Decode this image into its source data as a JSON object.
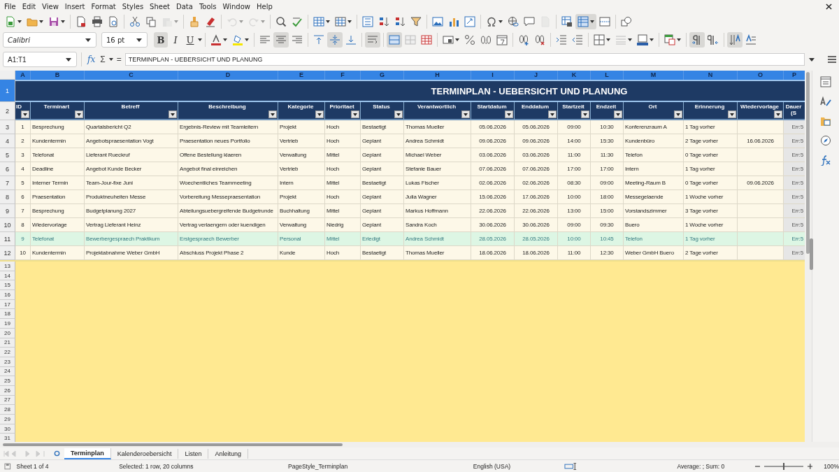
{
  "menu": [
    "File",
    "Edit",
    "View",
    "Insert",
    "Format",
    "Styles",
    "Sheet",
    "Data",
    "Tools",
    "Window",
    "Help"
  ],
  "standard_toolbar": {
    "paste_disabled": true,
    "undo_disabled": true,
    "redo_disabled": true,
    "header_footer_disabled": true,
    "freeze_active": true
  },
  "format_toolbar": {
    "font_name": "Calibri",
    "font_size": "16 pt",
    "text_buttons": [
      {
        "label": "B",
        "active": true
      },
      {
        "label": "I",
        "active": false
      },
      {
        "label": "U",
        "active": false
      }
    ],
    "align_left_active": false,
    "align_center_active": true,
    "align_right_active": false,
    "align_top_active": false,
    "align_middle_active": true,
    "align_bottom_active": false,
    "wrap_active": true,
    "merge_active": true,
    "ltr_active": true,
    "rtl_active": false,
    "vertical_text_active": true
  },
  "formula_bar": {
    "name_box": "A1:T1",
    "function_wizard": "fx",
    "sum": "Σ",
    "equals": "=",
    "content": "TERMINPLAN - UEBERSICHT UND PLANUNG"
  },
  "columns": [
    {
      "letter": "A",
      "selected": true,
      "header": "ID"
    },
    {
      "letter": "B",
      "selected": true,
      "header": "Terminart"
    },
    {
      "letter": "C",
      "selected": true,
      "header": "Betreff"
    },
    {
      "letter": "D",
      "selected": true,
      "header": "Beschreibung"
    },
    {
      "letter": "E",
      "selected": true,
      "header": "Kategorie"
    },
    {
      "letter": "F",
      "selected": true,
      "header": "Prioritaet"
    },
    {
      "letter": "G",
      "selected": true,
      "header": "Status"
    },
    {
      "letter": "H",
      "selected": true,
      "header": "Verantwortlich"
    },
    {
      "letter": "I",
      "selected": true,
      "header": "Startdatum"
    },
    {
      "letter": "J",
      "selected": true,
      "header": "Enddatum"
    },
    {
      "letter": "K",
      "selected": true,
      "header": "Startzeit"
    },
    {
      "letter": "L",
      "selected": true,
      "header": "Endzeit"
    },
    {
      "letter": "M",
      "selected": true,
      "header": "Ort"
    },
    {
      "letter": "N",
      "selected": true,
      "header": "Erinnerung"
    },
    {
      "letter": "O",
      "selected": true,
      "header": "Wiedervorlage"
    },
    {
      "letter": "P",
      "selected": true,
      "header": "Dauer (S"
    }
  ],
  "title_row": {
    "number": "1",
    "selected": true,
    "title": "TERMINPLAN - UEBERSICHT UND PLANUNG"
  },
  "header_row": {
    "number": "2",
    "selected": false
  },
  "rows": [
    {
      "number": "3",
      "highlighted": false,
      "cells": [
        "1",
        "Besprechung",
        "Quartalsbericht Q2",
        "Ergebnis-Review mit Teamleitern",
        "Projekt",
        "Hoch",
        "Bestaetigt",
        "Thomas Mueller",
        "05.06.2026",
        "05.06.2026",
        "09:00",
        "10:30",
        "Konferenzraum A",
        "1 Tag vorher",
        "",
        "Err:5"
      ]
    },
    {
      "number": "4",
      "highlighted": false,
      "cells": [
        "2",
        "Kundentermin",
        "Angebotspraesentation Vogt",
        "Praesentation neues Portfolio",
        "Vertrieb",
        "Hoch",
        "Geplant",
        "Andrea Schmidt",
        "09.06.2026",
        "09.06.2026",
        "14:00",
        "15:30",
        "Kundenbüro",
        "2 Tage vorher",
        "16.06.2026",
        "Err:5"
      ]
    },
    {
      "number": "5",
      "highlighted": false,
      "cells": [
        "3",
        "Telefonat",
        "Lieferant Rueckruf",
        "Offene Bestellung klaeren",
        "Verwaltung",
        "Mittel",
        "Geplant",
        "Michael Weber",
        "03.06.2026",
        "03.06.2026",
        "11:00",
        "11:30",
        "Telefon",
        "0 Tage vorher",
        "",
        "Err:5"
      ]
    },
    {
      "number": "6",
      "highlighted": false,
      "cells": [
        "4",
        "Deadline",
        "Angebot Kunde Becker",
        "Angebot final einreichen",
        "Vertrieb",
        "Hoch",
        "Geplant",
        "Stefanie Bauer",
        "07.06.2026",
        "07.06.2026",
        "17:00",
        "17:00",
        "Intern",
        "1 Tag vorher",
        "",
        "Err:5"
      ]
    },
    {
      "number": "7",
      "highlighted": false,
      "cells": [
        "5",
        "Interner Termin",
        "Team-Jour-fixe Juni",
        "Woechentliches Teammeeting",
        "Intern",
        "Mittel",
        "Bestaetigt",
        "Lukas Fischer",
        "02.06.2026",
        "02.06.2026",
        "08:30",
        "09:00",
        "Meeting-Raum B",
        "0 Tage vorher",
        "09.06.2026",
        "Err:5"
      ]
    },
    {
      "number": "8",
      "highlighted": false,
      "cells": [
        "6",
        "Praesentation",
        "Produktneuheiten Messe",
        "Vorbereitung Messepraesentation",
        "Projekt",
        "Hoch",
        "Geplant",
        "Julia Wagner",
        "15.06.2026",
        "17.06.2026",
        "10:00",
        "18:00",
        "Messegelaende",
        "1 Woche vorher",
        "",
        "Err:5"
      ]
    },
    {
      "number": "9",
      "highlighted": false,
      "cells": [
        "7",
        "Besprechung",
        "Budgetplanung 2027",
        "Abteilungsuebergreifende Budgetrunde",
        "Buchhaltung",
        "Mittel",
        "Geplant",
        "Markus Hoffmann",
        "22.06.2026",
        "22.06.2026",
        "13:00",
        "15:00",
        "Vorstandszimmer",
        "3 Tage vorher",
        "",
        "Err:5"
      ]
    },
    {
      "number": "10",
      "highlighted": false,
      "cells": [
        "8",
        "Wiedervorlage",
        "Vertrag Lieferant Heinz",
        "Vertrag verlaengern oder kuendigen",
        "Verwaltung",
        "Niedrig",
        "Geplant",
        "Sandra Koch",
        "30.06.2026",
        "30.06.2026",
        "09:00",
        "09:30",
        "Buero",
        "1 Woche vorher",
        "",
        "Err:5"
      ]
    },
    {
      "number": "11",
      "highlighted": true,
      "cells": [
        "9",
        "Telefonat",
        "Bewerbergespraech Praktikum",
        "Erstgespraech Bewerber",
        "Personal",
        "Mittel",
        "Erledigt",
        "Andrea Schmidt",
        "28.05.2026",
        "28.05.2026",
        "10:00",
        "10:45",
        "Telefon",
        "1 Tag vorher",
        "",
        "Err:5"
      ]
    },
    {
      "number": "12",
      "highlighted": false,
      "cells": [
        "10",
        "Kundentermin",
        "Projektabnahme Weber GmbH",
        "Abschluss Projekt Phase 2",
        "Kunde",
        "Hoch",
        "Bestaetigt",
        "Thomas Mueller",
        "18.06.2026",
        "18.06.2026",
        "11:00",
        "12:30",
        "Weber GmbH Buero",
        "2 Tage vorher",
        "",
        "Err:5"
      ]
    }
  ],
  "empty_rows": [
    "13",
    "14",
    "15",
    "16",
    "17",
    "18",
    "19",
    "20",
    "21",
    "22",
    "23",
    "24",
    "25",
    "26",
    "27",
    "28",
    "29",
    "30",
    "31"
  ],
  "sheet_tabs": [
    {
      "label": "Terminplan",
      "selected": true
    },
    {
      "label": "Kalenderoebersicht",
      "selected": false
    },
    {
      "label": "Listen",
      "selected": false
    },
    {
      "label": "Anleitung",
      "selected": false
    }
  ],
  "status_bar": {
    "sheet": "Sheet 1 of 4",
    "selection": "Selected: 1 row, 20 columns",
    "page_style": "PageStyle_Terminplan",
    "language": "English (USA)",
    "summary": "Average: ; Sum: 0",
    "zoom": {
      "level": 0.5,
      "reading": "100%"
    }
  }
}
